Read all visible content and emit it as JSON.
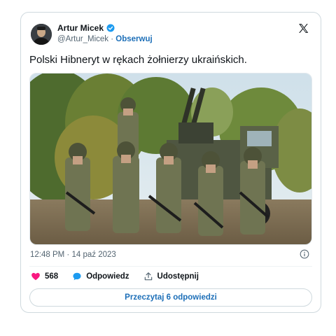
{
  "tweet": {
    "author_name": "Artur Micek",
    "handle": "@Artur_Micek",
    "separator": " · ",
    "follow_label": "Obserwuj",
    "text": "Polski Hibneryt w rękach żołnierzy ukraińskich.",
    "time": "12:48 PM",
    "date": "14 paź 2023",
    "likes_count": "568",
    "reply_label": "Odpowiedz",
    "share_label": "Udostępnij",
    "read_replies_label": "Przeczytaj 6 odpowiedzi"
  },
  "icons": {
    "verified": "verified-badge-icon",
    "platform": "x-logo-icon",
    "info": "info-icon",
    "like": "heart-icon",
    "reply": "speech-bubble-icon",
    "share": "share-upload-icon"
  },
  "colors": {
    "accent_blue": "#1d9bf0",
    "link_blue": "#1d6fb8",
    "like_pink": "#f91880",
    "text_gray": "#536471"
  }
}
